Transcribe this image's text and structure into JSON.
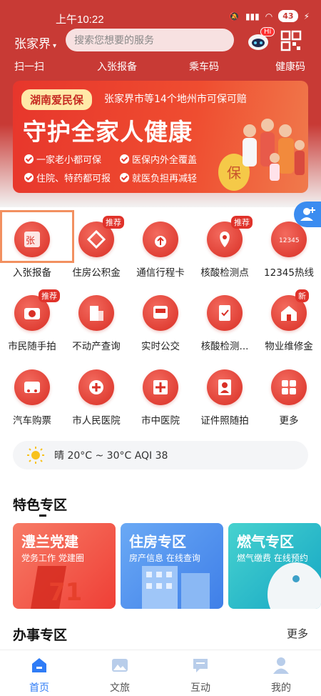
{
  "status": {
    "time": "上午10:22",
    "battery": "43"
  },
  "topbar": {
    "city": "张家界",
    "search_placeholder": "搜索您想要的服务",
    "robot_badge": "Hi"
  },
  "quick": [
    "扫一扫",
    "入张报备",
    "乘车码",
    "健康码"
  ],
  "banner": {
    "tag": "湖南爱民保",
    "subtitle": "张家界市等14个地州市可保可赔",
    "title": "守护全家人健康",
    "features": [
      "一家老小都可保",
      "医保内外全覆盖",
      "住院、特药都可报",
      "就医负担再减轻"
    ]
  },
  "services": [
    {
      "label": "入张报备",
      "icon": "report-icon",
      "badge": ""
    },
    {
      "label": "住房公积金",
      "icon": "housing-fund-icon",
      "badge": "推荐"
    },
    {
      "label": "通信行程卡",
      "icon": "trip-card-icon",
      "badge": ""
    },
    {
      "label": "核酸检测点",
      "icon": "test-point-icon",
      "badge": "推荐"
    },
    {
      "label": "12345热线",
      "icon": "hotline-icon",
      "badge": ""
    },
    {
      "label": "市民随手拍",
      "icon": "camera-icon",
      "badge": "推荐"
    },
    {
      "label": "不动产查询",
      "icon": "building-icon",
      "badge": ""
    },
    {
      "label": "实时公交",
      "icon": "bus-icon",
      "badge": ""
    },
    {
      "label": "核酸检测...",
      "icon": "test-result-icon",
      "badge": ""
    },
    {
      "label": "物业维修金",
      "icon": "property-icon",
      "badge": "新"
    },
    {
      "label": "汽车购票",
      "icon": "ticket-icon",
      "badge": ""
    },
    {
      "label": "市人民医院",
      "icon": "hospital-icon",
      "badge": ""
    },
    {
      "label": "市中医院",
      "icon": "tcm-hospital-icon",
      "badge": ""
    },
    {
      "label": "证件照随拍",
      "icon": "id-photo-icon",
      "badge": ""
    },
    {
      "label": "更多",
      "icon": "more-grid-icon",
      "badge": ""
    }
  ],
  "weather": {
    "text": "晴 20°C ~ 30°C AQI 38"
  },
  "special": {
    "title": "特色专区",
    "cards": [
      {
        "title": "澧兰党建",
        "sub": "党务工作 党建圈",
        "color": "#f25a4a"
      },
      {
        "title": "住房专区",
        "sub": "房产信息 在线查询",
        "color": "#4c8ff0"
      },
      {
        "title": "燃气专区",
        "sub": "燃气缴费 在线预约",
        "color": "#22b8c6"
      }
    ]
  },
  "office": {
    "title": "办事专区",
    "more": "更多"
  },
  "nav": [
    {
      "label": "首页",
      "active": true
    },
    {
      "label": "文旅",
      "active": false
    },
    {
      "label": "互动",
      "active": false
    },
    {
      "label": "我的",
      "active": false
    }
  ],
  "colors": {
    "primary_red": "#c83a35",
    "accent_blue": "#2f7cf6"
  }
}
